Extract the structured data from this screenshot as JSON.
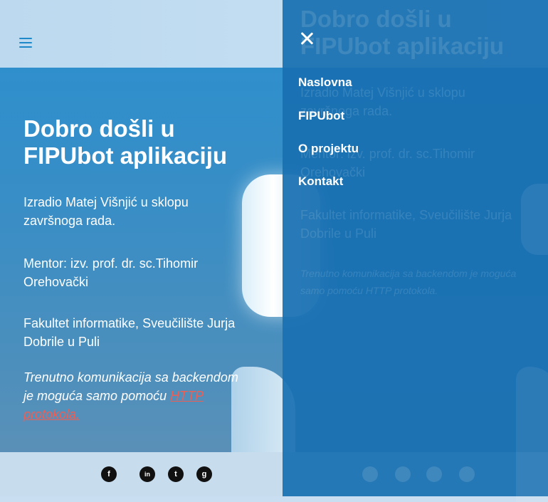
{
  "hero": {
    "title": "Dobro došli u FIPUbot aplikaciju",
    "author": "Izradio Matej Višnjić u sklopu završnoga rada.",
    "mentor": "Mentor: izv. prof. dr. sc.Tihomir Orehovački",
    "faculty": "Fakultet informatike, Sveučilište Jurja Dobrile u Puli",
    "note_text": "Trenutno komunikacija sa backendom je moguća samo pomoću ",
    "note_link": "HTTP protokola."
  },
  "menu": {
    "items": [
      {
        "label": "Naslovna"
      },
      {
        "label": "FIPUbot"
      },
      {
        "label": "O projektu"
      },
      {
        "label": "Kontakt"
      }
    ]
  },
  "social": [
    {
      "icon": "facebook-icon",
      "glyph": "f"
    },
    {
      "icon": "linkedin-icon",
      "glyph": "in"
    },
    {
      "icon": "twitter-icon",
      "glyph": "t"
    },
    {
      "icon": "github-icon",
      "glyph": "g"
    }
  ],
  "colors": {
    "accent": "#1e88c8",
    "link": "#f25d52",
    "overlay": "#1970b2"
  }
}
